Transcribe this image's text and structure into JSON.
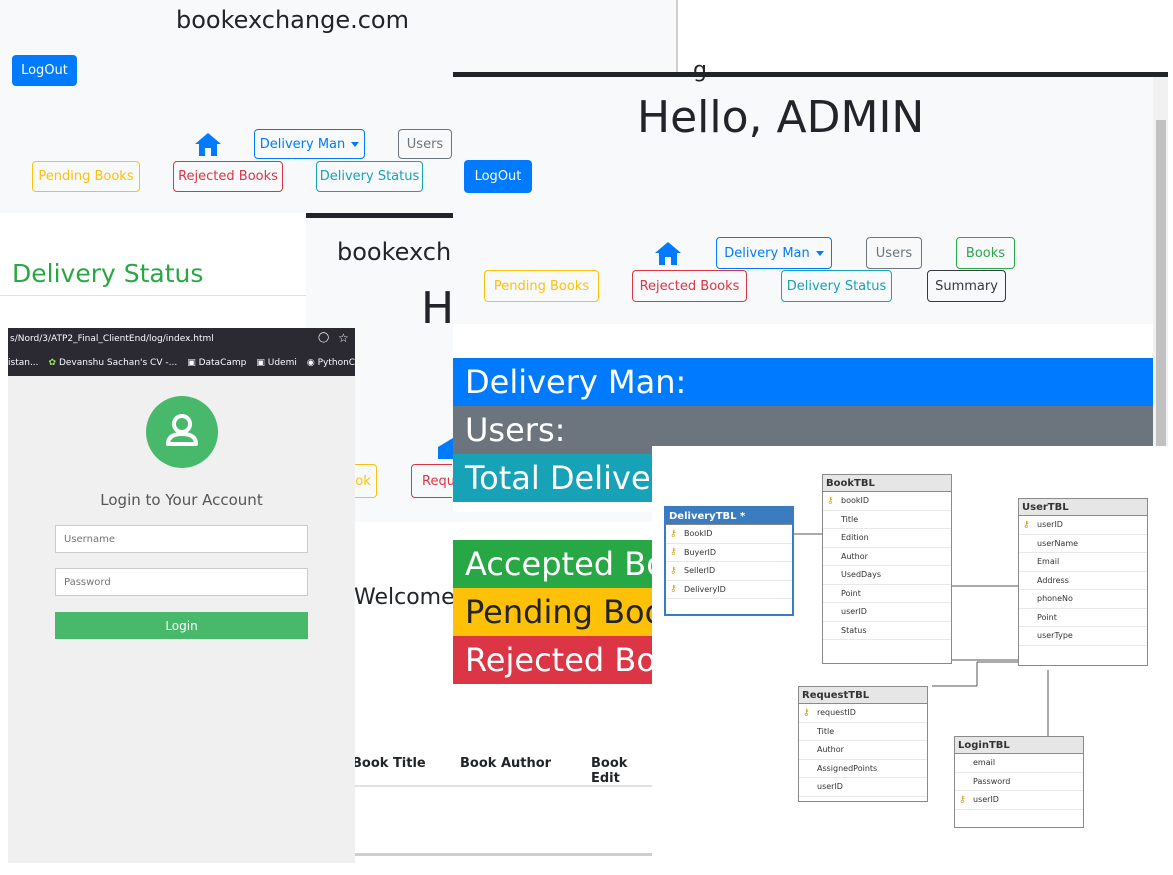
{
  "back_window": {
    "site_title": "bookexchange.com",
    "logout_label": "LogOut",
    "nav": {
      "delivery_man": "Delivery Man",
      "users": "Users",
      "pending_books": "Pending Books",
      "rejected_books": "Rejected Books",
      "delivery_status": "Delivery Status"
    }
  },
  "delivery_status_page": {
    "heading": "Delivery Status"
  },
  "partial_page": {
    "site_title": "bookexch",
    "hello_fragment": "H",
    "pending_fragment": "ok",
    "rejected_fragment": "Requ",
    "welcome_fragment": "Welcome",
    "table_headers": [
      "Book Title",
      "Book Author",
      "Book Edit"
    ]
  },
  "admin_window": {
    "cut_title": "g",
    "greeting": "Hello, ADMIN",
    "logout_label": "LogOut",
    "nav": {
      "delivery_man": "Delivery Man",
      "users": "Users",
      "books": "Books",
      "pending_books": "Pending Books",
      "rejected_books": "Rejected Books",
      "delivery_status": "Delivery Status",
      "summary": "Summary"
    },
    "cards": [
      {
        "label": "Delivery Man:",
        "color": "#007bff"
      },
      {
        "label": "Users:",
        "color": "#6c757d"
      },
      {
        "label": "Total Deliver",
        "color": "#17a2b8"
      },
      {
        "label": "Accepted Bo",
        "color": "#28a745"
      },
      {
        "label": "Pending Boo",
        "color": "#ffc107"
      },
      {
        "label": "Rejected Boo",
        "color": "#dc3545"
      }
    ]
  },
  "browser": {
    "url": "s/Nord/3/ATP2_Final_ClientEnd/log/index.html",
    "bookmarks": [
      "istan...",
      "Devanshu Sachan's CV -...",
      "DataCamp",
      "Udemi",
      "PythonCheatsheet"
    ]
  },
  "login": {
    "title": "Login to Your Account",
    "username_placeholder": "Username",
    "password_placeholder": "Password",
    "login_label": "Login",
    "accent": "#48b96b"
  },
  "er_diagram": {
    "tables": {
      "delivery": {
        "name": "DeliveryTBL *",
        "fields": [
          "BookID",
          "BuyerID",
          "SellerID",
          "DeliveryID"
        ]
      },
      "book": {
        "name": "BookTBL",
        "fields": [
          "bookID",
          "Title",
          "Edition",
          "Author",
          "UsedDays",
          "Point",
          "userID",
          "Status"
        ]
      },
      "user": {
        "name": "UserTBL",
        "fields": [
          "userID",
          "userName",
          "Email",
          "Address",
          "phoneNo",
          "Point",
          "userType"
        ]
      },
      "request": {
        "name": "RequestTBL",
        "fields": [
          "requestID",
          "Title",
          "Author",
          "AssignedPoints",
          "userID"
        ]
      },
      "login": {
        "name": "LoginTBL",
        "fields": [
          "email",
          "Password",
          "userID"
        ]
      }
    }
  }
}
